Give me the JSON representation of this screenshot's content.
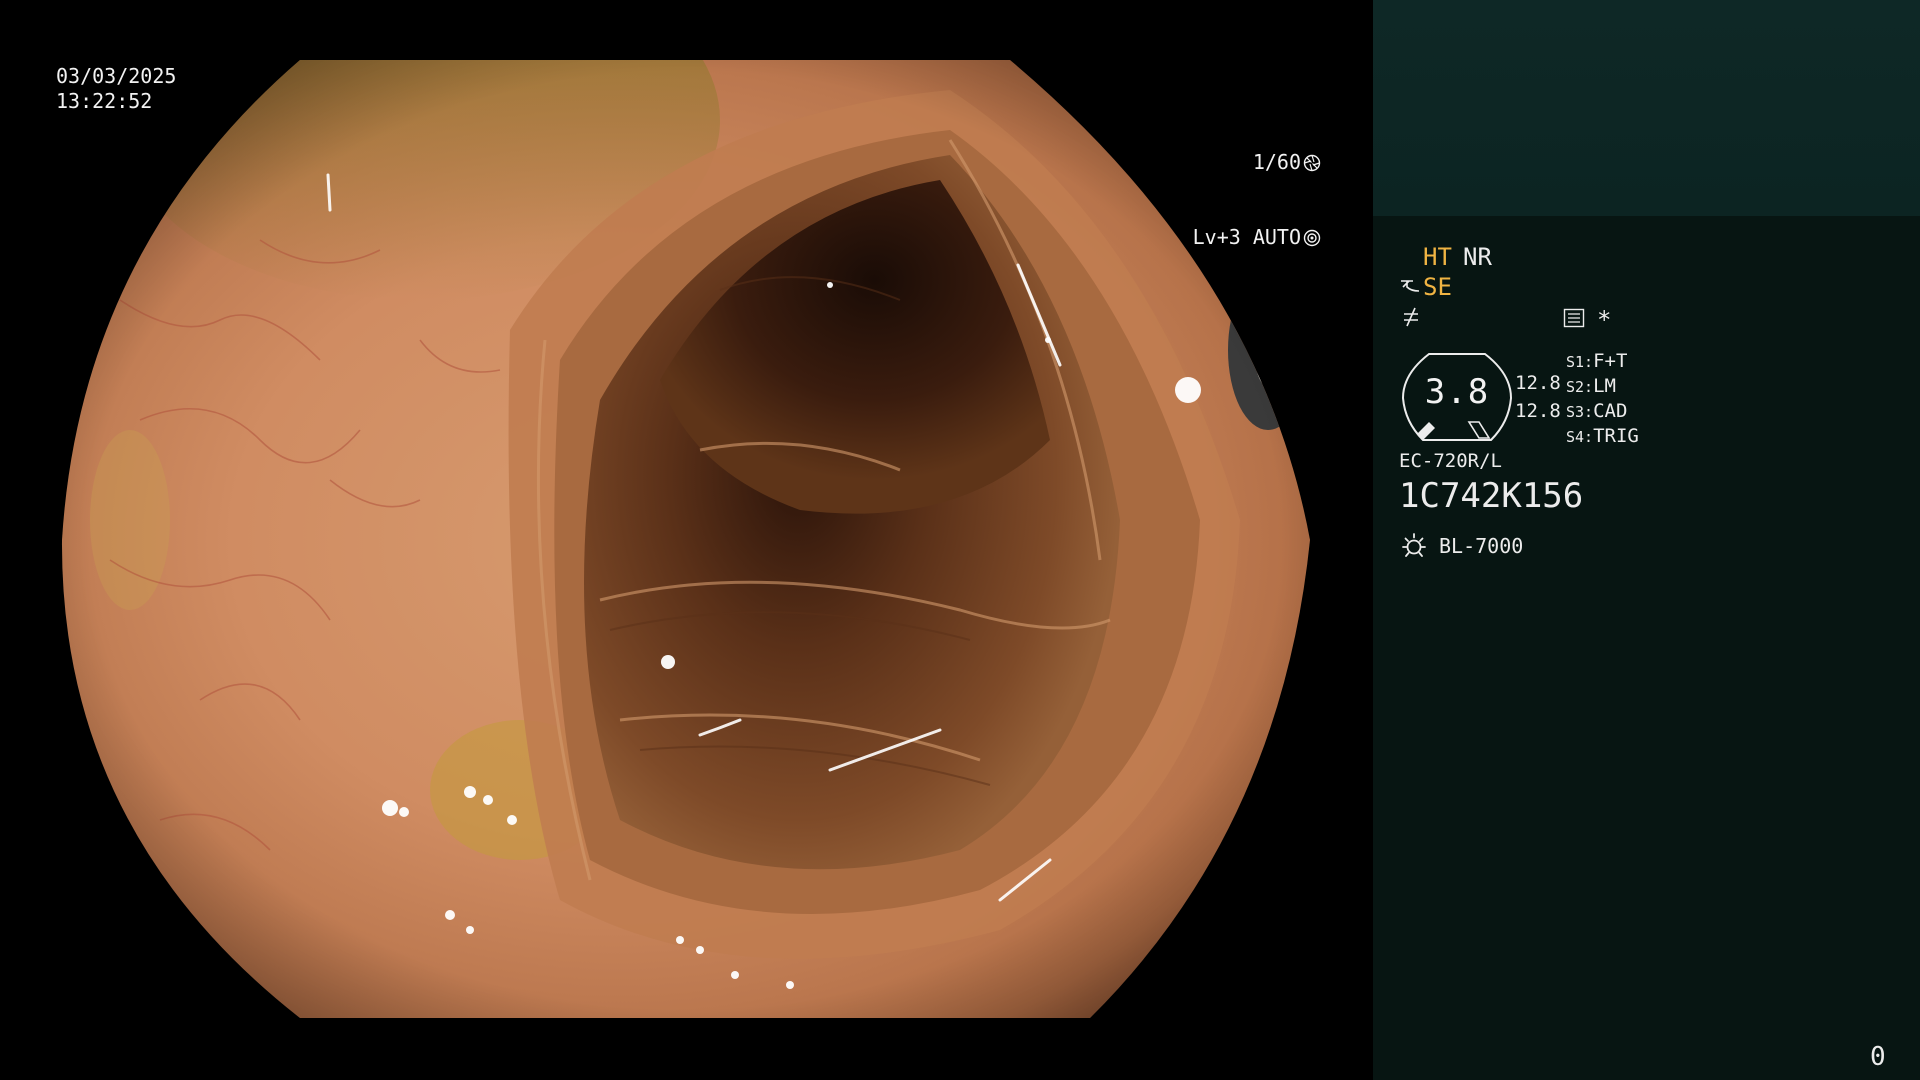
{
  "datetime": {
    "date": "03/03/2025",
    "time": "13:22:52"
  },
  "exposure": {
    "shutter": "1/60",
    "shutter_icon": "aperture-icon",
    "level": "Lv+3 AUTO",
    "auto_icon": "iris-icon"
  },
  "modes": {
    "ht": "HT",
    "nr": "NR",
    "se": "SE",
    "enhance_icon": "enhance-icon",
    "freeze_icon": "freeze-icon",
    "record_icon": "record-icon",
    "record_mark": "*"
  },
  "gauge": {
    "value": "3.8",
    "scale_top": "12.8",
    "scale_bottom": "12.8"
  },
  "switches": [
    {
      "key": "S1:",
      "value": "F+T"
    },
    {
      "key": "S2:",
      "value": "LM"
    },
    {
      "key": "S3:",
      "value": "CAD"
    },
    {
      "key": "S4:",
      "value": "TRIG"
    }
  ],
  "scope": {
    "model": "EC-720R/L",
    "serial": "1C742K156"
  },
  "light_source": {
    "icon": "lamp-icon",
    "model": "BL-7000"
  },
  "counter": "0",
  "colors": {
    "accent_yellow": "#f0b443",
    "panel_background": "#071512",
    "thumbnail_background": "#0e2826",
    "text": "#ececec"
  }
}
